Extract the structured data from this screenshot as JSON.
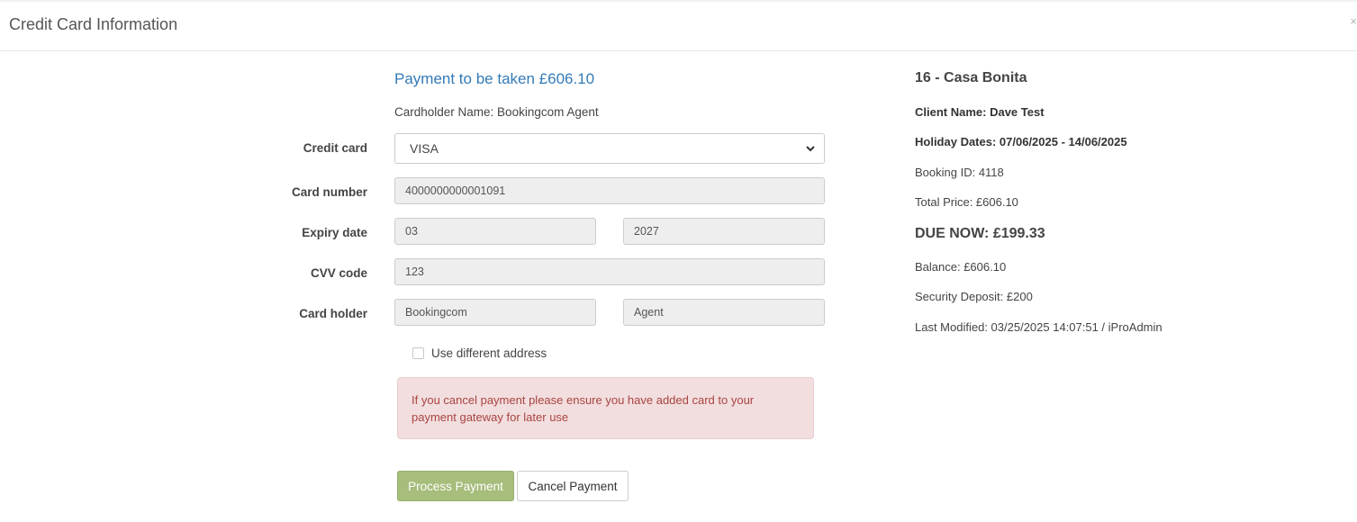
{
  "modal": {
    "title": "Credit Card Information",
    "close_glyph": "×"
  },
  "payment": {
    "title": "Payment to be taken £606.10",
    "cardholder_line": "Cardholder Name: Bookingcom Agent"
  },
  "form": {
    "credit_card_label": "Credit card",
    "credit_card_value": "VISA",
    "card_number_label": "Card number",
    "card_number_value": "4000000000001091",
    "expiry_label": "Expiry date",
    "expiry_month": "03",
    "expiry_year": "2027",
    "cvv_label": "CVV code",
    "cvv_value": "123",
    "holder_label": "Card holder",
    "holder_first": "Bookingcom",
    "holder_last": "Agent",
    "different_address_label": "Use different address",
    "different_address_checked": false
  },
  "alert": {
    "text": "If you cancel payment please ensure you have added card to your payment gateway for later use"
  },
  "buttons": {
    "process": "Process Payment",
    "cancel": "Cancel Payment"
  },
  "booking": {
    "property": "16 - Casa Bonita",
    "client_name": "Client Name: Dave Test",
    "holiday_dates": "Holiday Dates: 07/06/2025 - 14/06/2025",
    "booking_id": "Booking ID: 4118",
    "total_price": "Total Price: £606.10",
    "due_now": "DUE NOW: £199.33",
    "balance": "Balance: £606.10",
    "security_deposit": "Security Deposit: £200",
    "last_modified": "Last Modified: 03/25/2025 14:07:51 / iProAdmin"
  },
  "colors": {
    "title_blue": "#337ab7",
    "process_button": "#a6bd7b",
    "alert_bg": "#f2dede",
    "alert_text": "#a94442"
  }
}
